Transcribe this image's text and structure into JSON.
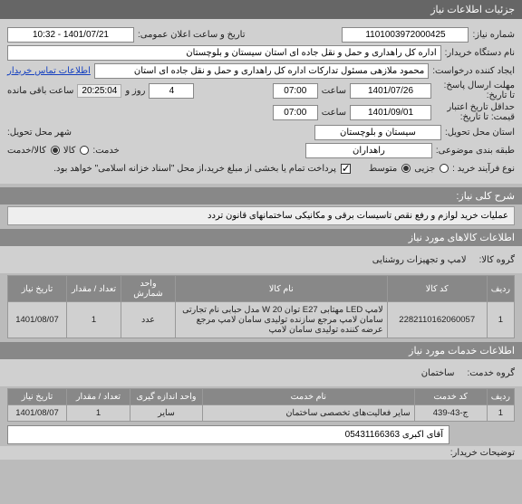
{
  "header": {
    "title": "جزئیات اطلاعات نیاز"
  },
  "info": {
    "need_number_label": "شماره نیاز:",
    "need_number": "1101003972000425",
    "public_announce_label": "تاریخ و ساعت اعلان عمومی:",
    "public_announce": "1401/07/21 - 10:32",
    "buyer_org_label": "نام دستگاه خریدار:",
    "buyer_org": "اداره کل راهداری و حمل و نقل جاده ای استان سیستان و بلوچستان",
    "creator_label": "ایجاد کننده درخواست:",
    "creator": "محمود ملازهی مسئول تدارکات اداره کل راهداری و حمل و نقل جاده ای استان",
    "buyer_contact_link": "اطلاعات تماس خریدار",
    "deadline_label": "مهلت ارسال پاسخ:",
    "deadline_until_label": "تا تاریخ:",
    "deadline_date": "1401/07/26",
    "hour_label": "ساعت",
    "deadline_time": "07:00",
    "day_label": "روز و",
    "days_remaining": "4",
    "remaining_label": "ساعت باقی مانده",
    "countdown": "20:25:04",
    "price_valid_label": "حداقل تاریخ اعتبار",
    "price_valid_label2": "قیمت: تا تاریخ:",
    "price_valid_date": "1401/09/01",
    "price_valid_time": "07:00",
    "province_label": "استان محل تحویل:",
    "province": "سیستان و بلوچستان",
    "city_label": "شهر محل تحویل:",
    "subject_label": "طبقه بندی موضوعی:",
    "subject": "راهداران",
    "service_label": "خدمت:",
    "opt_goods": "کالا",
    "opt_goods_service": "کالا/خدمت",
    "process_label": "نوع فرآیند خرید :",
    "opt_small": "جزیی",
    "opt_medium": "متوسط",
    "payment_note": "پرداخت تمام یا بخشی از مبلغ خرید،از محل \"اسناد خزانه اسلامی\" خواهد بود.",
    "payment_check": true
  },
  "general": {
    "header": "شرح کلی نیاز:",
    "text": "عملیات خرید لوازم و رفع نقص تاسیسات برقی و مکانیکی ساختمانهای قانون تردد"
  },
  "goods_section": {
    "header": "اطلاعات کالاهای مورد نیاز",
    "group_label": "گروه کالا:",
    "group_value": "لامپ و تجهیزات روشنایی",
    "columns": {
      "row": "ردیف",
      "code": "کد کالا",
      "name": "نام کالا",
      "unit": "واحد شمارش",
      "qty": "تعداد / مقدار",
      "need_date": "تاریخ نیاز"
    },
    "rows": [
      {
        "row": "1",
        "code": "2282110162060057",
        "name": "لامپ LED مهتابی E27 توان W 20 مدل حبابی نام تجارتی سامان لامپ مرجع سازنده تولیدی سامان لامپ مرجع عرضه کننده تولیدی سامان لامپ",
        "unit": "عدد",
        "qty": "1",
        "need_date": "1401/08/07"
      }
    ]
  },
  "services_section": {
    "header": "اطلاعات خدمات مورد نیاز",
    "group_label": "گروه خدمت:",
    "group_value": "ساختمان",
    "columns": {
      "row": "ردیف",
      "code": "کد خدمت",
      "name": "نام خدمت",
      "unit": "واحد اندازه گیری",
      "qty": "تعداد / مقدار",
      "need_date": "تاریخ نیاز"
    },
    "rows": [
      {
        "row": "1",
        "code": "ج-43-439",
        "name": "سایر فعالیت‌های تخصصی ساختمان",
        "unit": "سایر",
        "qty": "1",
        "need_date": "1401/08/07"
      }
    ]
  },
  "seller": {
    "label": "توضیحات خریدار:",
    "text": "آقای اکبری 05431166363"
  }
}
